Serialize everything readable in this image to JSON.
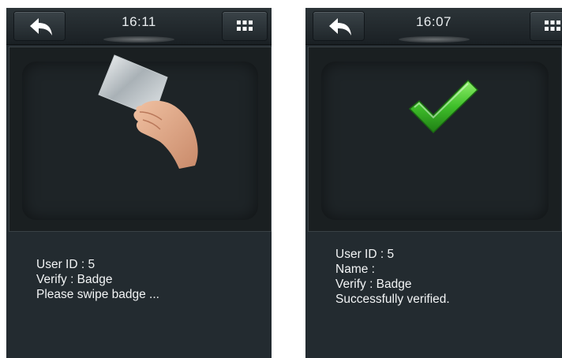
{
  "left_screen": {
    "time": "16:11",
    "lines": [
      "User ID : 5",
      "Verify : Badge",
      "Please swipe badge ..."
    ]
  },
  "right_screen": {
    "time": "16:07",
    "lines": [
      "User ID : 5",
      "Name :",
      "Verify : Badge",
      "Successfully verified."
    ]
  },
  "icons": {
    "back": "back-arrow-icon",
    "menu": "grid-menu-icon",
    "prompt_image": "hand-holding-badge-icon",
    "status_image": "green-checkmark-icon"
  },
  "colors": {
    "screen_bg": "#232b30",
    "text": "#f2f4f5",
    "check_green": "#3fbf2a"
  }
}
